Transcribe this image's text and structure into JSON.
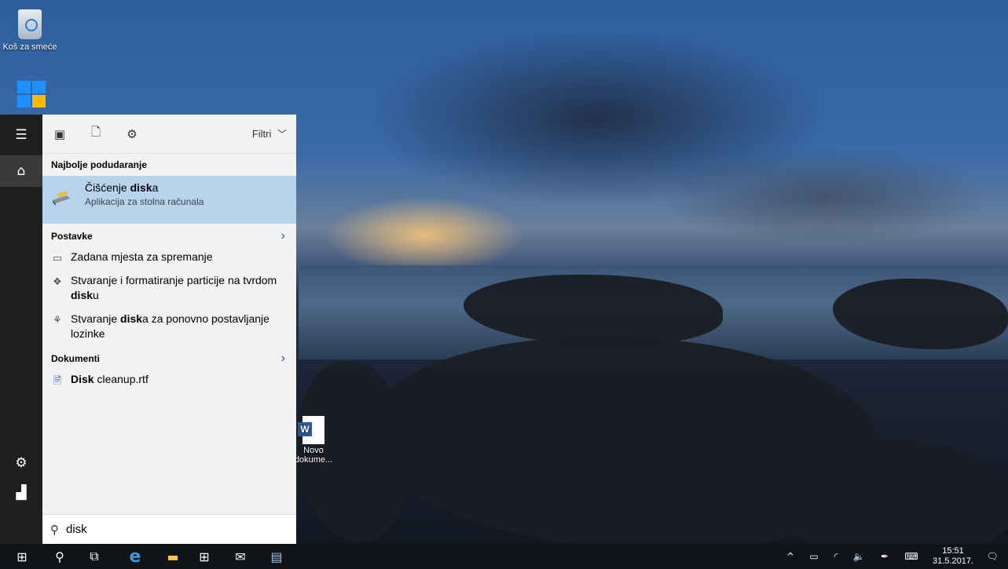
{
  "desktop": {
    "icons": [
      {
        "label": "Koš za smeće"
      },
      {
        "label": "Novo\ndokume..."
      }
    ]
  },
  "rail": {
    "items": [
      "menu-icon",
      "home-icon",
      "settings-icon",
      "user-icon"
    ]
  },
  "panel": {
    "filter_label": "Filtri",
    "best_match_header": "Najbolje podudaranje",
    "best_match": {
      "title_prefix": "Čišćenje ",
      "title_bold": "disk",
      "title_suffix": "a",
      "subtitle": "Aplikacija za stolna računala"
    },
    "settings_header": "Postavke",
    "settings_items": [
      {
        "pre": "Zadana mjesta za spremanje",
        "bold": "",
        "post": ""
      },
      {
        "pre": "Stvaranje i formatiranje particije na tvrdom ",
        "bold": "disk",
        "post": "u"
      },
      {
        "pre": "Stvaranje ",
        "bold": "disk",
        "post": "a za ponovno postavljanje lozinke"
      }
    ],
    "documents_header": "Dokumenti",
    "document_items": [
      {
        "bold": "Disk",
        "post": " cleanup.rtf"
      }
    ],
    "search_value": "disk"
  },
  "taskbar": {
    "clock_time": "15:51",
    "clock_date": "31.5.2017."
  }
}
